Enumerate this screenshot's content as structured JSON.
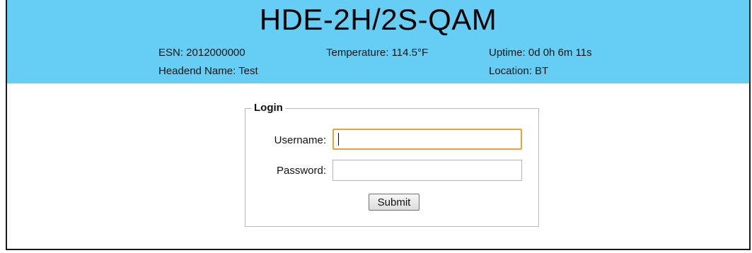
{
  "header": {
    "title": "HDE-2H/2S-QAM",
    "esn": "ESN: 2012000000",
    "temperature": "Temperature: 114.5°F",
    "uptime": "Uptime: 0d 0h 6m 11s",
    "headend_name": "Headend Name: Test",
    "location": "Location:  BT",
    "background_color": "#66cef4"
  },
  "login": {
    "legend": "Login",
    "username_label": "Username:",
    "username_value": "",
    "password_label": "Password:",
    "password_value": "",
    "submit_label": "Submit",
    "focus_color": "#e6a33b"
  }
}
